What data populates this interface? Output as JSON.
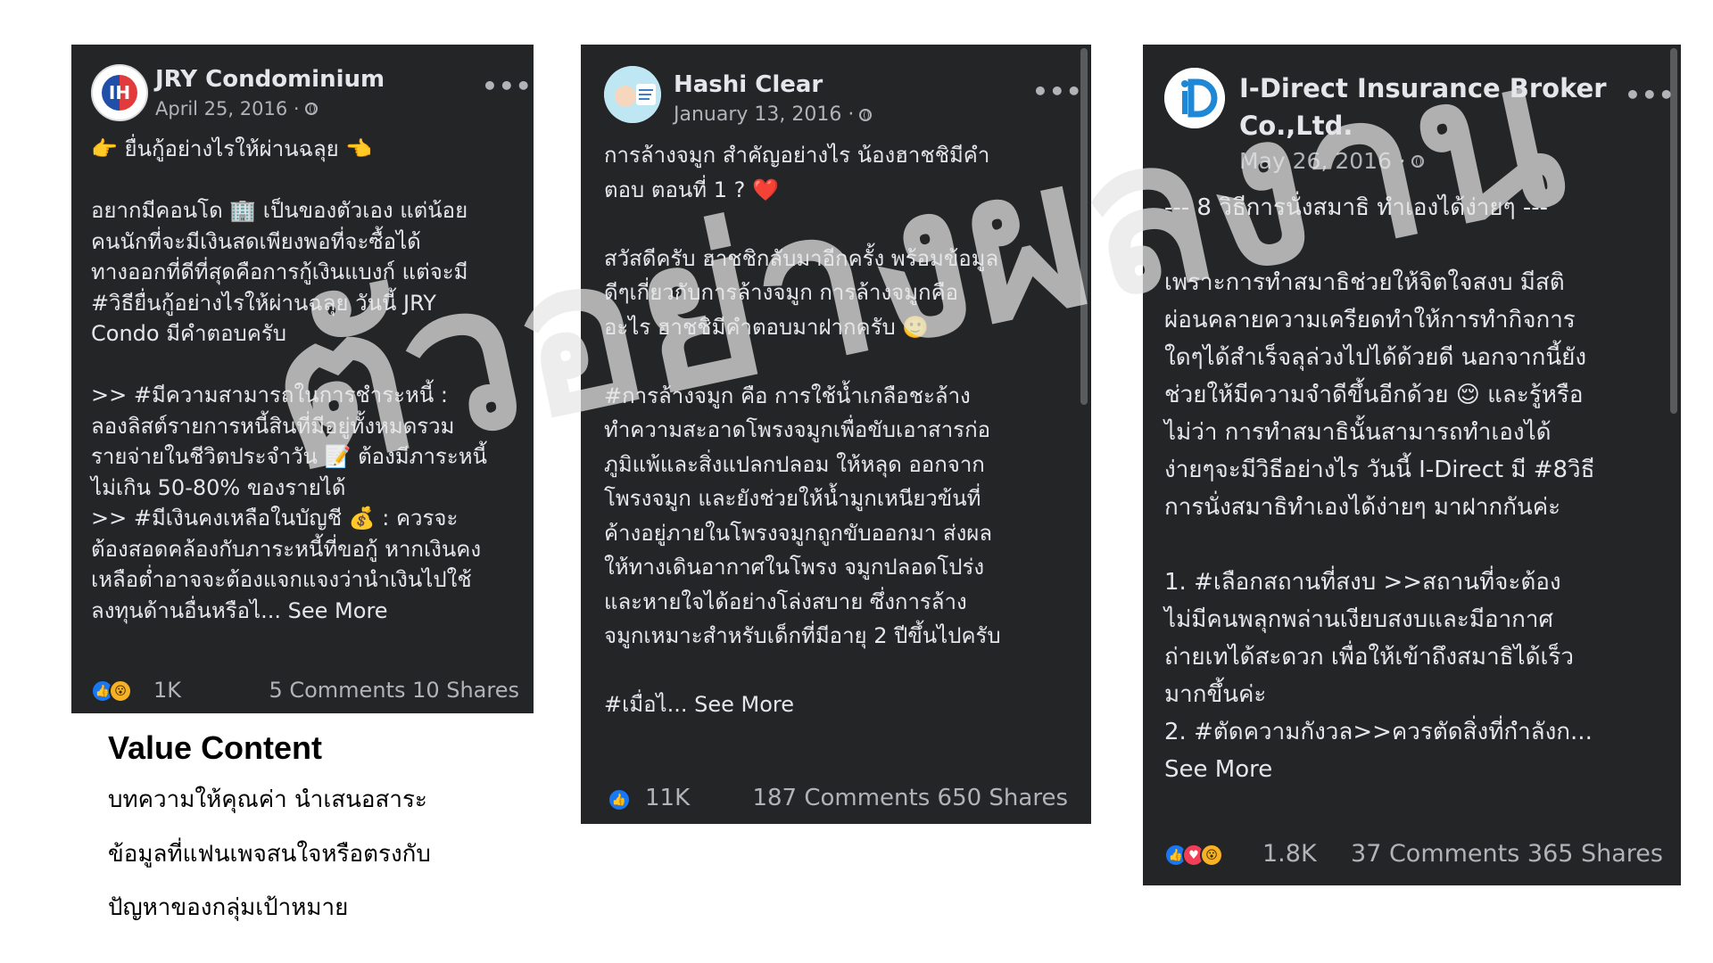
{
  "posts": [
    {
      "page_name": "JRY Condominium",
      "date": "April 25, 2016 ·",
      "body": "👉 ยื่นกู้อย่างไรให้ผ่านฉลุย 👈\n\nอยากมีคอนโด 🏢 เป็นของตัวเอง แต่น้อย\nคนนักที่จะมีเงินสดเพียงพอที่จะซื้อได้\nทางออกที่ดีที่สุดคือการกู้เงินแบงก์ แต่จะมี\n#วิธียื่นกู้อย่างไรให้ผ่านฉลุย วันนี้ JRY\nCondo มีคำตอบครับ\n\n>> #มีความสามารถในการชำระหนี้ :\nลองลิสต์รายการหนี้สินที่มีอยู่ทั้งหมดรวม\nรายจ่ายในชีวิตประจำวัน 📝 ต้องมีภาระหนี้\nไม่เกิน 50-80% ของรายได้\n>> #มีเงินคงเหลือในบัญชี 💰 : ควรจะ\nต้องสอดคล้องกับภาระหนี้ที่ขอกู้ หากเงินคง\nเหลือต่ำอาจจะต้องแจกแจงว่านำเงินไปใช้\nลงทุนด้านอื่นหรือไ... See More",
      "reaction_count": "1K",
      "stats": "5 Comments  10 Shares"
    },
    {
      "page_name": "Hashi Clear",
      "date": "January 13, 2016 ·",
      "body": "การล้างจมูก สำคัญอย่างไร น้องฮาชชิมีคำ\nตอบ ตอนที่ 1 ? ❤️\n\nสวัสดีครับ ฮาชชิกลับมาอีกครั้ง พร้อมข้อมูล\nดีๆเกี่ยวกับการล้างจมูก การล้างจมูกคือ\nอะไร ฮาชชิมีคำตอบมาฝากครับ 🙂\n\n#การล้างจมูก คือ การใช้น้ำเกลือชะล้าง\nทำความสะอาดโพรงจมูกเพื่อขับเอาสารก่อ\nภูมิแพ้และสิ่งแปลกปลอม ให้หลุด ออกจาก\nโพรงจมูก และยังช่วยให้น้ำมูกเหนียวข้นที่\nค้างอยู่ภายในโพรงจมูกถูกขับออกมา ส่งผล\nให้ทางเดินอากาศในโพรง จมูกปลอดโปร่ง\nและหายใจได้อย่างโล่งสบาย ซึ่งการล้าง\nจมูกเหมาะสำหรับเด็กที่มีอายุ 2 ปีขึ้นไปครับ\n\n#เมื่อไ... See More",
      "reaction_count": "11K",
      "stats": "187 Comments  650 Shares"
    },
    {
      "page_name": "I-Direct Insurance Broker\nCo.,Ltd.",
      "date": "May 26, 2016 ·",
      "body": "--- 8 วิธีการนั่งสมาธิ ทำเองได้ง่ายๆ ---\n\nเพราะการทำสมาธิช่วยให้จิตใจสงบ มีสติ\nผ่อนคลายความเครียดทำให้การทำกิจการ\nใดๆได้สำเร็จลุล่วงไปได้ด้วยดี นอกจากนี้ยัง\nช่วยให้มีความจำดีขึ้นอีกด้วย 😌 และรู้หรือ\nไม่ว่า การทำสมาธินั้นสามารถทำเองได้\nง่ายๆจะมีวิธีอย่างไร วันนี้ I-Direct มี #8วิธี\nการนั่งสมาธิทำเองได้ง่ายๆ มาฝากกันค่ะ\n\n1. #เลือกสถานที่สงบ >>สถานที่จะต้อง\nไม่มีคนพลุกพล่านเงียบสงบและมีอากาศ\nถ่ายเทได้สะดวก เพื่อให้เข้าถึงสมาธิได้เร็ว\nมากขึ้นค่ะ\n2. #ตัดความกังวล>>ควรตัดสิ่งที่กำลังก...\nSee More",
      "reaction_count": "1.8K",
      "stats": "37 Comments  365 Shares"
    }
  ],
  "icons": {
    "like": "👍",
    "heart": "♥",
    "wow": "😮",
    "globe": "globe-icon",
    "more": "•••"
  },
  "avatars": {
    "jry": "IH",
    "hashi": "hashi",
    "idirect": "iD"
  },
  "caption": {
    "title": "Value Content",
    "lines": [
      "บทความให้คุณค่า  นำเสนอสาระ",
      "ข้อมูลที่แฟนเพจสนใจหรือตรงกับ",
      "ปัญหาของกลุ่มเป้าหมาย"
    ]
  },
  "watermark": "ตัวอย่างผลงาน",
  "colors": {
    "post_bg": "#242526",
    "text": "#e4e6eb",
    "secondary": "#b0b3b8",
    "like": "#1877f2",
    "heart": "#f33e58",
    "wow": "#f7b125"
  }
}
